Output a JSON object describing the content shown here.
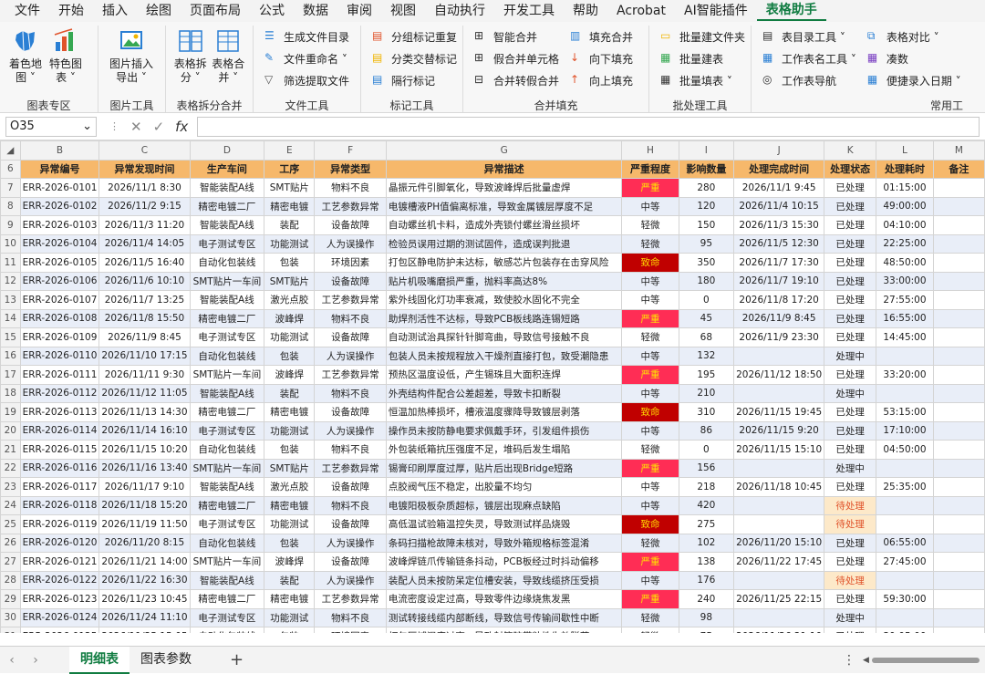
{
  "menu": [
    "文件",
    "开始",
    "插入",
    "绘图",
    "页面布局",
    "公式",
    "数据",
    "审阅",
    "视图",
    "自动执行",
    "开发工具",
    "帮助",
    "Acrobat",
    "AI智能插件",
    "表格助手"
  ],
  "ribbon": {
    "chart_group": {
      "btn1": "着色地图 ˅",
      "btn1a": "着色地",
      "btn1b": "图 ˅",
      "btn2a": "特色图",
      "btn2b": "表 ˅",
      "label": "图表专区"
    },
    "image_group": {
      "btn_a": "图片插入",
      "btn_b": "导出 ˅",
      "label": "图片工具"
    },
    "split_group": {
      "btn1a": "表格拆",
      "btn1b": "分 ˅",
      "btn2a": "表格合",
      "btn2b": "并 ˅",
      "label": "表格拆分合并"
    },
    "file_group": {
      "items": [
        "生成文件目录",
        "文件重命名 ˅",
        "筛选提取文件"
      ],
      "label": "文件工具"
    },
    "mark_group": {
      "items": [
        "分组标记重复",
        "分类交替标记",
        "隔行标记"
      ],
      "label": "标记工具"
    },
    "merge_group": {
      "col1": [
        "智能合并",
        "假合并单元格",
        "合并转假合并"
      ],
      "col2": [
        "填充合并",
        "向下填充",
        "向上填充"
      ],
      "label": "合并填充"
    },
    "batch_group": {
      "items": [
        "批量建文件夹",
        "批量建表",
        "批量填表 ˅"
      ],
      "label": "批处理工具"
    },
    "common_group": {
      "col1": [
        "表目录工具 ˅",
        "工作表名工具 ˅",
        "工作表导航"
      ],
      "col2": [
        "表格对比 ˅",
        "凑数",
        "便捷录入日期 ˅"
      ],
      "label": "常用工"
    }
  },
  "formula_bar": {
    "cell_ref": "O35",
    "cancel": "✕",
    "confirm": "✓",
    "fx": "fx",
    "content": ""
  },
  "columns": [
    "B",
    "C",
    "D",
    "E",
    "F",
    "G",
    "H",
    "I",
    "J",
    "K",
    "L",
    "M"
  ],
  "headers": [
    "异常编号",
    "异常发现时间",
    "生产车间",
    "工序",
    "异常类型",
    "异常描述",
    "严重程度",
    "影响数量",
    "处理完成时间",
    "处理状态",
    "处理耗时",
    "备注"
  ],
  "first_row_num": 6,
  "rows": [
    [
      "ERR-2026-0101",
      "2026/11/1 8:30",
      "智能装配A线",
      "SMT贴片",
      "物料不良",
      "晶振元件引脚氧化，导致波峰焊后批量虚焊",
      "严重",
      "280",
      "2026/11/1 9:45",
      "已处理",
      "01:15:00",
      ""
    ],
    [
      "ERR-2026-0102",
      "2026/11/2 9:15",
      "精密电镀二厂",
      "精密电镀",
      "工艺参数异常",
      "电镀槽液PH值偏离标准，导致金属镀层厚度不足",
      "中等",
      "120",
      "2026/11/4 10:15",
      "已处理",
      "49:00:00",
      ""
    ],
    [
      "ERR-2026-0103",
      "2026/11/3 11:20",
      "智能装配A线",
      "装配",
      "设备故障",
      "自动螺丝机卡料，造成外壳锁付螺丝滑丝损坏",
      "轻微",
      "150",
      "2026/11/3 15:30",
      "已处理",
      "04:10:00",
      ""
    ],
    [
      "ERR-2026-0104",
      "2026/11/4 14:05",
      "电子测试专区",
      "功能测试",
      "人为误操作",
      "检验员误用过期的测试固件，造成误判批退",
      "轻微",
      "95",
      "2026/11/5 12:30",
      "已处理",
      "22:25:00",
      ""
    ],
    [
      "ERR-2026-0105",
      "2026/11/5 16:40",
      "自动化包装线",
      "包装",
      "环境因素",
      "打包区静电防护未达标，敏感芯片包装存在击穿风险",
      "致命",
      "350",
      "2026/11/7 17:30",
      "已处理",
      "48:50:00",
      ""
    ],
    [
      "ERR-2026-0106",
      "2026/11/6 10:10",
      "SMT贴片一车间",
      "SMT贴片",
      "设备故障",
      "贴片机吸嘴磨损严重，抛料率高达8%",
      "中等",
      "180",
      "2026/11/7 19:10",
      "已处理",
      "33:00:00",
      ""
    ],
    [
      "ERR-2026-0107",
      "2026/11/7 13:25",
      "智能装配A线",
      "激光点胶",
      "工艺参数异常",
      "紫外线固化灯功率衰减，致使胶水固化不完全",
      "中等",
      "0",
      "2026/11/8 17:20",
      "已处理",
      "27:55:00",
      ""
    ],
    [
      "ERR-2026-0108",
      "2026/11/8 15:50",
      "精密电镀二厂",
      "波峰焊",
      "物料不良",
      "助焊剂活性不达标，导致PCB板线路连锡短路",
      "严重",
      "45",
      "2026/11/9 8:45",
      "已处理",
      "16:55:00",
      ""
    ],
    [
      "ERR-2026-0109",
      "2026/11/9 8:45",
      "电子测试专区",
      "功能测试",
      "设备故障",
      "自动测试治具探针针脚弯曲，导致信号接触不良",
      "轻微",
      "68",
      "2026/11/9 23:30",
      "已处理",
      "14:45:00",
      ""
    ],
    [
      "ERR-2026-0110",
      "2026/11/10 17:15",
      "自动化包装线",
      "包装",
      "人为误操作",
      "包装人员未按规程放入干燥剂直接打包，致受潮隐患",
      "中等",
      "132",
      "",
      "处理中",
      "",
      ""
    ],
    [
      "ERR-2026-0111",
      "2026/11/11 9:30",
      "SMT贴片一车间",
      "波峰焊",
      "工艺参数异常",
      "预热区温度设低，产生锡珠且大面积连焊",
      "严重",
      "195",
      "2026/11/12 18:50",
      "已处理",
      "33:20:00",
      ""
    ],
    [
      "ERR-2026-0112",
      "2026/11/12 11:05",
      "智能装配A线",
      "装配",
      "物料不良",
      "外壳结构件配合公差超差，导致卡扣断裂",
      "中等",
      "210",
      "",
      "处理中",
      "",
      ""
    ],
    [
      "ERR-2026-0113",
      "2026/11/13 14:30",
      "精密电镀二厂",
      "精密电镀",
      "设备故障",
      "恒温加热棒损坏，槽液温度骤降导致镀层剥落",
      "致命",
      "310",
      "2026/11/15 19:45",
      "已处理",
      "53:15:00",
      ""
    ],
    [
      "ERR-2026-0114",
      "2026/11/14 16:10",
      "电子测试专区",
      "功能测试",
      "人为误操作",
      "操作员未按防静电要求佩戴手环，引发组件损伤",
      "中等",
      "86",
      "2026/11/15 9:20",
      "已处理",
      "17:10:00",
      ""
    ],
    [
      "ERR-2026-0115",
      "2026/11/15 10:20",
      "自动化包装线",
      "包装",
      "物料不良",
      "外包装纸箱抗压强度不足，堆码后发生塌陷",
      "轻微",
      "0",
      "2026/11/15 15:10",
      "已处理",
      "04:50:00",
      ""
    ],
    [
      "ERR-2026-0116",
      "2026/11/16 13:40",
      "SMT贴片一车间",
      "SMT贴片",
      "工艺参数异常",
      "锡膏印刷厚度过厚，贴片后出现Bridge短路",
      "严重",
      "156",
      "",
      "处理中",
      "",
      ""
    ],
    [
      "ERR-2026-0117",
      "2026/11/17 9:10",
      "智能装配A线",
      "激光点胶",
      "设备故障",
      "点胶阀气压不稳定，出胶量不均匀",
      "中等",
      "218",
      "2026/11/18 10:45",
      "已处理",
      "25:35:00",
      ""
    ],
    [
      "ERR-2026-0118",
      "2026/11/18 15:20",
      "精密电镀二厂",
      "精密电镀",
      "物料不良",
      "电镀阳极板杂质超标，镀层出现麻点缺陷",
      "中等",
      "420",
      "",
      "待处理",
      "",
      ""
    ],
    [
      "ERR-2026-0119",
      "2026/11/19 11:50",
      "电子测试专区",
      "功能测试",
      "设备故障",
      "高低温试验箱温控失灵，导致测试样品烧毁",
      "致命",
      "275",
      "",
      "待处理",
      "",
      ""
    ],
    [
      "ERR-2026-0120",
      "2026/11/20 8:15",
      "自动化包装线",
      "包装",
      "人为误操作",
      "条码扫描枪故障未核对，导致外箱规格标签混淆",
      "轻微",
      "102",
      "2026/11/20 15:10",
      "已处理",
      "06:55:00",
      ""
    ],
    [
      "ERR-2026-0121",
      "2026/11/21 14:00",
      "SMT贴片一车间",
      "波峰焊",
      "设备故障",
      "波峰焊链爪传输链条抖动，PCB板经过时抖动偏移",
      "严重",
      "138",
      "2026/11/22 17:45",
      "已处理",
      "27:45:00",
      ""
    ],
    [
      "ERR-2026-0122",
      "2026/11/22 16:30",
      "智能装配A线",
      "装配",
      "人为误操作",
      "装配人员未按防呆定位槽安装，导致线缆挤压受损",
      "中等",
      "176",
      "",
      "待处理",
      "",
      ""
    ],
    [
      "ERR-2026-0123",
      "2026/11/23 10:45",
      "精密电镀二厂",
      "精密电镀",
      "工艺参数异常",
      "电流密度设定过高，导致零件边缘烧焦发黑",
      "严重",
      "240",
      "2026/11/25 22:15",
      "已处理",
      "59:30:00",
      ""
    ],
    [
      "ERR-2026-0124",
      "2026/11/24 11:10",
      "电子测试专区",
      "功能测试",
      "物料不良",
      "测试转接线缆内部断线，导致信号传输间歇性中断",
      "轻微",
      "98",
      "",
      "处理中",
      "",
      ""
    ],
    [
      "ERR-2026-0125",
      "2026/11/25 15:05",
      "自动化包装线",
      "包装",
      "环境因素",
      "打包区域湿度过高，导致封箱胶带粘性失效脱落",
      "轻微",
      "75",
      "2026/11/26 21:10",
      "已处理",
      "30:05:00",
      ""
    ]
  ],
  "sheet_tabs": [
    "明细表",
    "图表参数"
  ],
  "active_tab": "明细表",
  "colors": {
    "header_bg": "#f6b86b",
    "band_bg": "#e9eef8",
    "severe": "#ff2d55",
    "fatal": "#c00000",
    "pending": "#fde9c9",
    "accent": "#107c41"
  }
}
